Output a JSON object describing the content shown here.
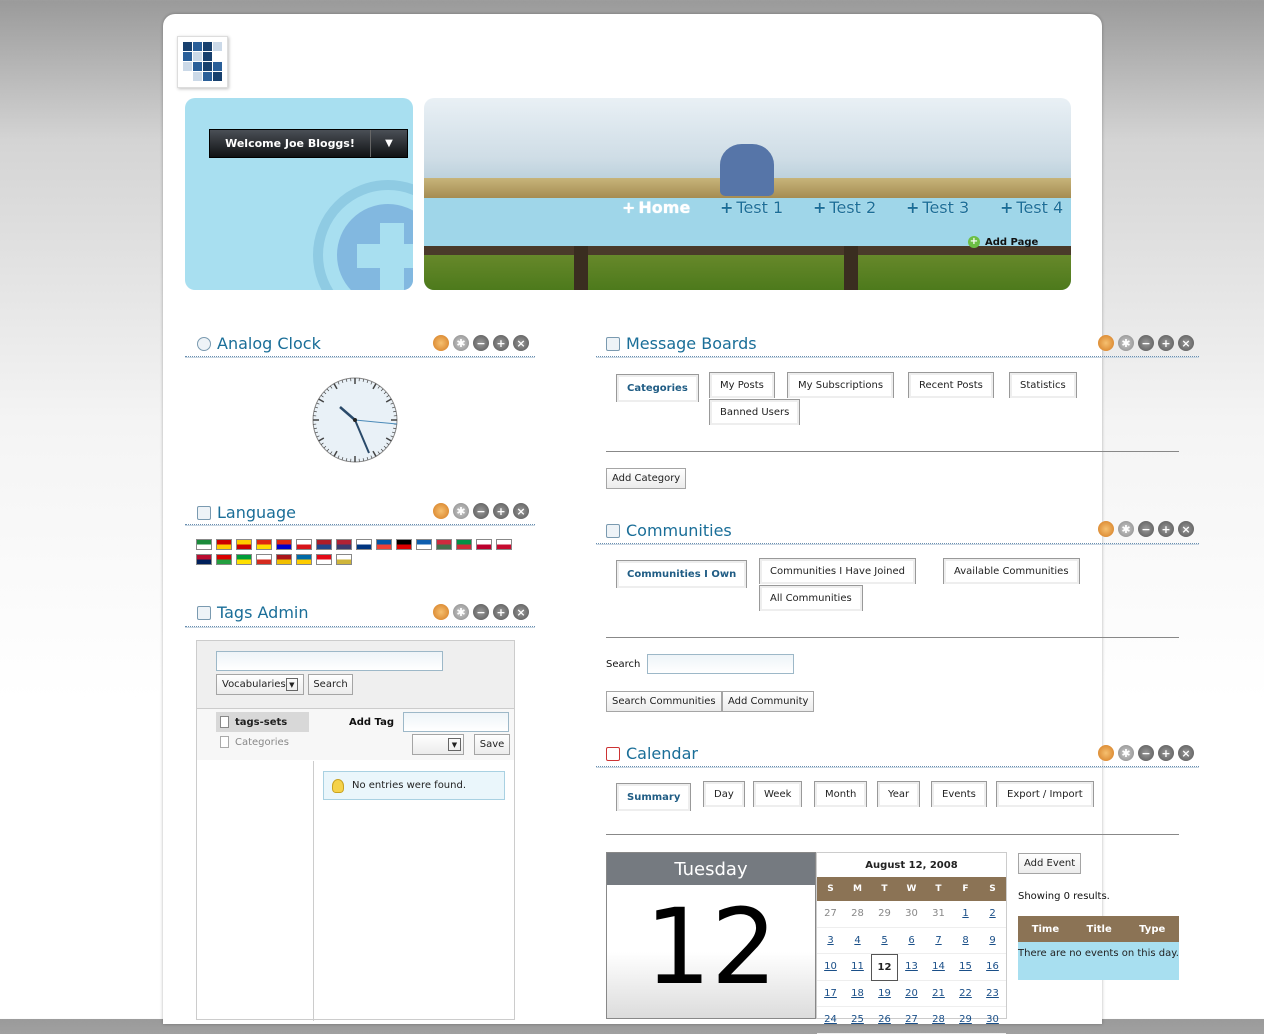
{
  "header": {
    "welcome": "Welcome Joe Bloggs!",
    "add_page": "Add Page",
    "nav": [
      {
        "label": "Home",
        "active": true
      },
      {
        "label": "Test 1",
        "active": false
      },
      {
        "label": "Test 2",
        "active": false
      },
      {
        "label": "Test 3",
        "active": false
      },
      {
        "label": "Test 4",
        "active": false
      }
    ]
  },
  "portlets": {
    "clock": {
      "title": "Analog Clock"
    },
    "language": {
      "title": "Language",
      "flag_count": 24
    },
    "tags": {
      "title": "Tags Admin",
      "vocabularies": "Vocabularies",
      "search": "Search",
      "item_selected": "tags-sets",
      "item_other": "Categories",
      "add_tag": "Add Tag",
      "save": "Save",
      "no_entries": "No entries were found."
    },
    "message_boards": {
      "title": "Message Boards",
      "tabs": [
        "Categories",
        "My Posts",
        "My Subscriptions",
        "Recent Posts",
        "Statistics",
        "Banned Users"
      ],
      "add_category": "Add Category"
    },
    "communities": {
      "title": "Communities",
      "tabs": [
        "Communities I Own",
        "Communities I Have Joined",
        "Available Communities",
        "All Communities"
      ],
      "search_label": "Search",
      "search_button": "Search Communities",
      "add_button": "Add Community"
    },
    "calendar": {
      "title": "Calendar",
      "tabs": [
        "Summary",
        "Day",
        "Week",
        "Month",
        "Year",
        "Events",
        "Export / Import"
      ],
      "weekday": "Tuesday",
      "day": "12",
      "month_label": "August 12, 2008",
      "dow": [
        "S",
        "M",
        "T",
        "W",
        "T",
        "F",
        "S"
      ],
      "days": [
        {
          "d": "27",
          "out": true
        },
        {
          "d": "28",
          "out": true
        },
        {
          "d": "29",
          "out": true
        },
        {
          "d": "30",
          "out": true
        },
        {
          "d": "31",
          "out": true
        },
        {
          "d": "1"
        },
        {
          "d": "2"
        },
        {
          "d": "3"
        },
        {
          "d": "4"
        },
        {
          "d": "5"
        },
        {
          "d": "6"
        },
        {
          "d": "7"
        },
        {
          "d": "8"
        },
        {
          "d": "9"
        },
        {
          "d": "10"
        },
        {
          "d": "11"
        },
        {
          "d": "12",
          "today": true
        },
        {
          "d": "13"
        },
        {
          "d": "14"
        },
        {
          "d": "15"
        },
        {
          "d": "16"
        },
        {
          "d": "17"
        },
        {
          "d": "18"
        },
        {
          "d": "19"
        },
        {
          "d": "20"
        },
        {
          "d": "21"
        },
        {
          "d": "22"
        },
        {
          "d": "23"
        },
        {
          "d": "24"
        },
        {
          "d": "25"
        },
        {
          "d": "26"
        },
        {
          "d": "27"
        },
        {
          "d": "28"
        },
        {
          "d": "29"
        },
        {
          "d": "30"
        }
      ],
      "add_event": "Add Event",
      "showing": "Showing 0 results.",
      "cols": [
        "Time",
        "Title",
        "Type"
      ],
      "empty": "There are no events on this day."
    }
  },
  "colors": {
    "accent": "#1a6e98",
    "dock": "#a8dff0",
    "table_head": "#8b7355"
  },
  "icons": {
    "tool_buttons": [
      "palette-icon",
      "gear-icon",
      "minimize-icon",
      "maximize-icon",
      "close-icon"
    ]
  }
}
